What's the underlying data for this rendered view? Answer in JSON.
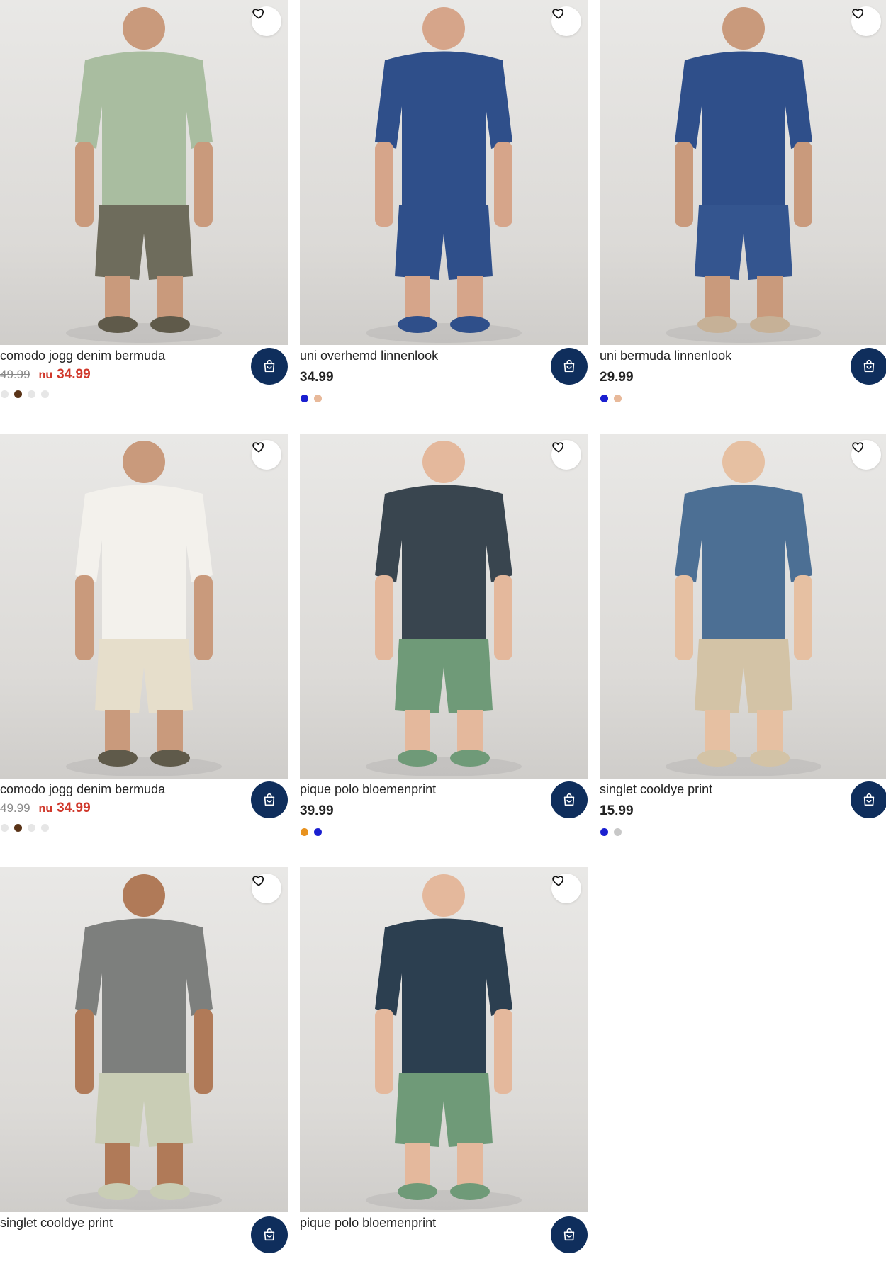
{
  "products": [
    {
      "name": "comodo jogg denim bermuda",
      "price_old": "49.99",
      "price_prefix": "nu",
      "price": "34.99",
      "sale": true,
      "swatches": [
        "#e6e6e6",
        "#5a3418",
        "#e6e6e6",
        "#e6e6e6"
      ],
      "colors": {
        "top": "#a9bda0",
        "bottom": "#6e6c5c",
        "shoe": "#5f5a4a",
        "skin": "#c99a7c"
      },
      "wishlist_icon": "heart-icon",
      "cart_icon": "shopping-bag-icon"
    },
    {
      "name": "uni overhemd linnenlook",
      "price": "34.99",
      "sale": false,
      "swatches": [
        "#1a1fd0",
        "#e8b99a"
      ],
      "colors": {
        "top": "#2f4f8a",
        "bottom": "#2f4f8a",
        "shoe": "#2f4f8a",
        "skin": "#d6a58a"
      },
      "wishlist_icon": "heart-icon",
      "cart_icon": "shopping-bag-icon"
    },
    {
      "name": "uni bermuda linnenlook",
      "price": "29.99",
      "sale": false,
      "swatches": [
        "#1a1fd0",
        "#e8b99a"
      ],
      "colors": {
        "top": "#2f4f8a",
        "bottom": "#34558f",
        "shoe": "#c6b197",
        "skin": "#c99a7c"
      },
      "wishlist_icon": "heart-icon",
      "cart_icon": "shopping-bag-icon"
    },
    {
      "name": "comodo jogg denim bermuda",
      "price_old": "49.99",
      "price_prefix": "nu",
      "price": "34.99",
      "sale": true,
      "swatches": [
        "#e6e6e6",
        "#5a3418",
        "#e6e6e6",
        "#e6e6e6"
      ],
      "colors": {
        "top": "#f3f1ec",
        "bottom": "#e6decb",
        "shoe": "#5f5a4a",
        "skin": "#c99a7c"
      },
      "wishlist_icon": "heart-icon",
      "cart_icon": "shopping-bag-icon"
    },
    {
      "name": "pique polo bloemenprint",
      "price": "39.99",
      "sale": false,
      "swatches": [
        "#e8921e",
        "#1a1fd0"
      ],
      "colors": {
        "top": "#39454f",
        "bottom": "#6f9a78",
        "shoe": "#6f9a78",
        "skin": "#e4b89c"
      },
      "wishlist_icon": "heart-icon",
      "cart_icon": "shopping-bag-icon"
    },
    {
      "name": "singlet cooldye print",
      "price": "15.99",
      "sale": false,
      "swatches": [
        "#1a1fd0",
        "#c8c8c8"
      ],
      "colors": {
        "top": "#4c6f94",
        "bottom": "#d3c3a6",
        "shoe": "#d3c3a6",
        "skin": "#e6c0a2"
      },
      "wishlist_icon": "heart-icon",
      "cart_icon": "shopping-bag-icon"
    },
    {
      "name": "singlet cooldye print",
      "sale": false,
      "colors": {
        "top": "#7d7f7d",
        "bottom": "#c9cdb5",
        "shoe": "#c9cdb5",
        "skin": "#b07a58"
      },
      "wishlist_icon": "heart-icon",
      "cart_icon": "shopping-bag-icon"
    },
    {
      "name": "pique polo bloemenprint",
      "sale": false,
      "colors": {
        "top": "#2c3f50",
        "bottom": "#6f9a78",
        "shoe": "#6f9a78",
        "skin": "#e4b89c"
      },
      "wishlist_icon": "heart-icon",
      "cart_icon": "shopping-bag-icon"
    }
  ],
  "accent_color": "#0f2e5c",
  "sale_color": "#d0382b"
}
